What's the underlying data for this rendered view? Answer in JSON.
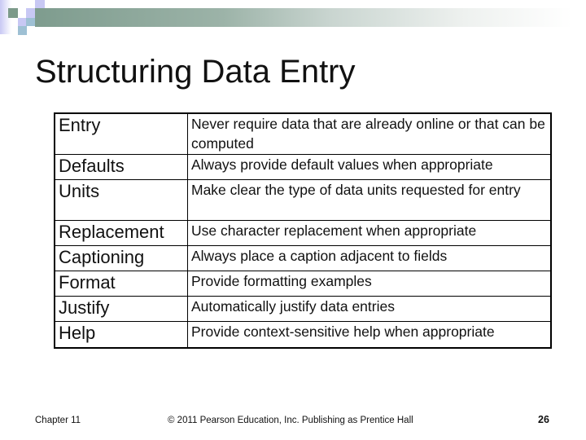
{
  "slide": {
    "title": "Structuring Data Entry",
    "table": {
      "rows": [
        {
          "term": "Entry",
          "description": "Never require data that are already online or that can be computed"
        },
        {
          "term": "Defaults",
          "description": "Always provide default values when appropriate"
        },
        {
          "term": "Units",
          "description": "Make clear the type of data units requested for entry"
        },
        {
          "term": "Replacement",
          "description": "Use character replacement when appropriate"
        },
        {
          "term": "Captioning",
          "description": "Always place a caption adjacent to fields"
        },
        {
          "term": "Format",
          "description": "Provide formatting examples"
        },
        {
          "term": "Justify",
          "description": "Automatically justify data entries"
        },
        {
          "term": "Help",
          "description": "Provide context-sensitive help when appropriate"
        }
      ]
    },
    "footer": {
      "chapter": "Chapter 11",
      "copyright": "© 2011 Pearson Education, Inc. Publishing as Prentice Hall",
      "page_number": "26"
    }
  },
  "colors": {
    "header_bar_start": "#7e9c8e",
    "header_accent_lavender": "#c8c8f4",
    "header_accent_blue": "#9ec0d4",
    "text": "#111111",
    "border": "#000000"
  }
}
